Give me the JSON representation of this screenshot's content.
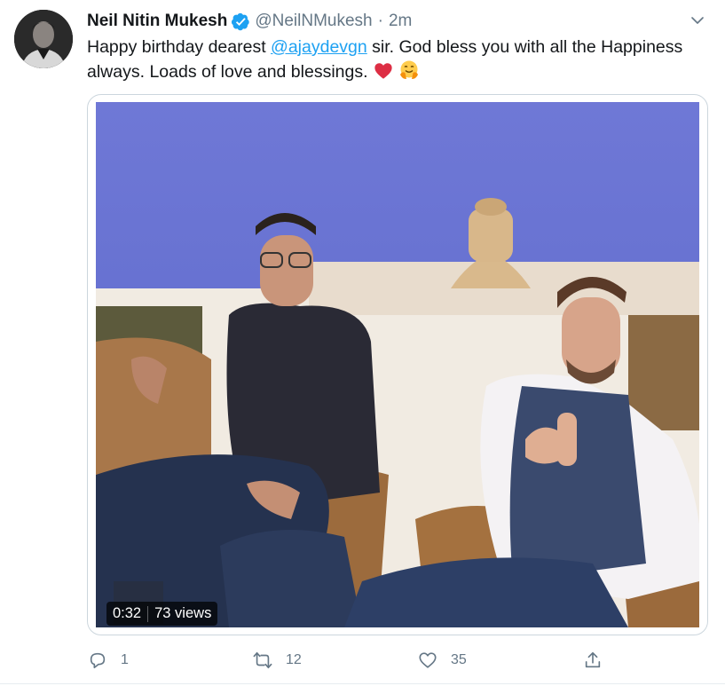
{
  "tweet": {
    "name": "Neil Nitin Mukesh",
    "handle": "@NeilNMukesh",
    "separator": "·",
    "time": "2m",
    "text_before": "Happy birthday dearest ",
    "mention": "@ajaydevgn",
    "text_after": " sir. God bless you with all the Happiness always. Loads of love and blessings.",
    "emojis": [
      "heart-emoji",
      "hugging-face-emoji"
    ]
  },
  "video": {
    "duration": "0:32",
    "views": "73 views"
  },
  "actions": {
    "reply_count": "1",
    "retweet_count": "12",
    "like_count": "35"
  },
  "colors": {
    "accent": "#1da1f2",
    "muted": "#657786",
    "heart": "#e0245e"
  }
}
